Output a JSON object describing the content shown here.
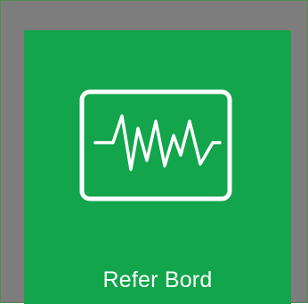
{
  "tile": {
    "label": "Refer Bord",
    "icon": "heartbeat-monitor-icon",
    "background_color": "#12a54c",
    "text_color": "#ffffff"
  },
  "frame": {
    "background_color": "#7d7d7d"
  }
}
